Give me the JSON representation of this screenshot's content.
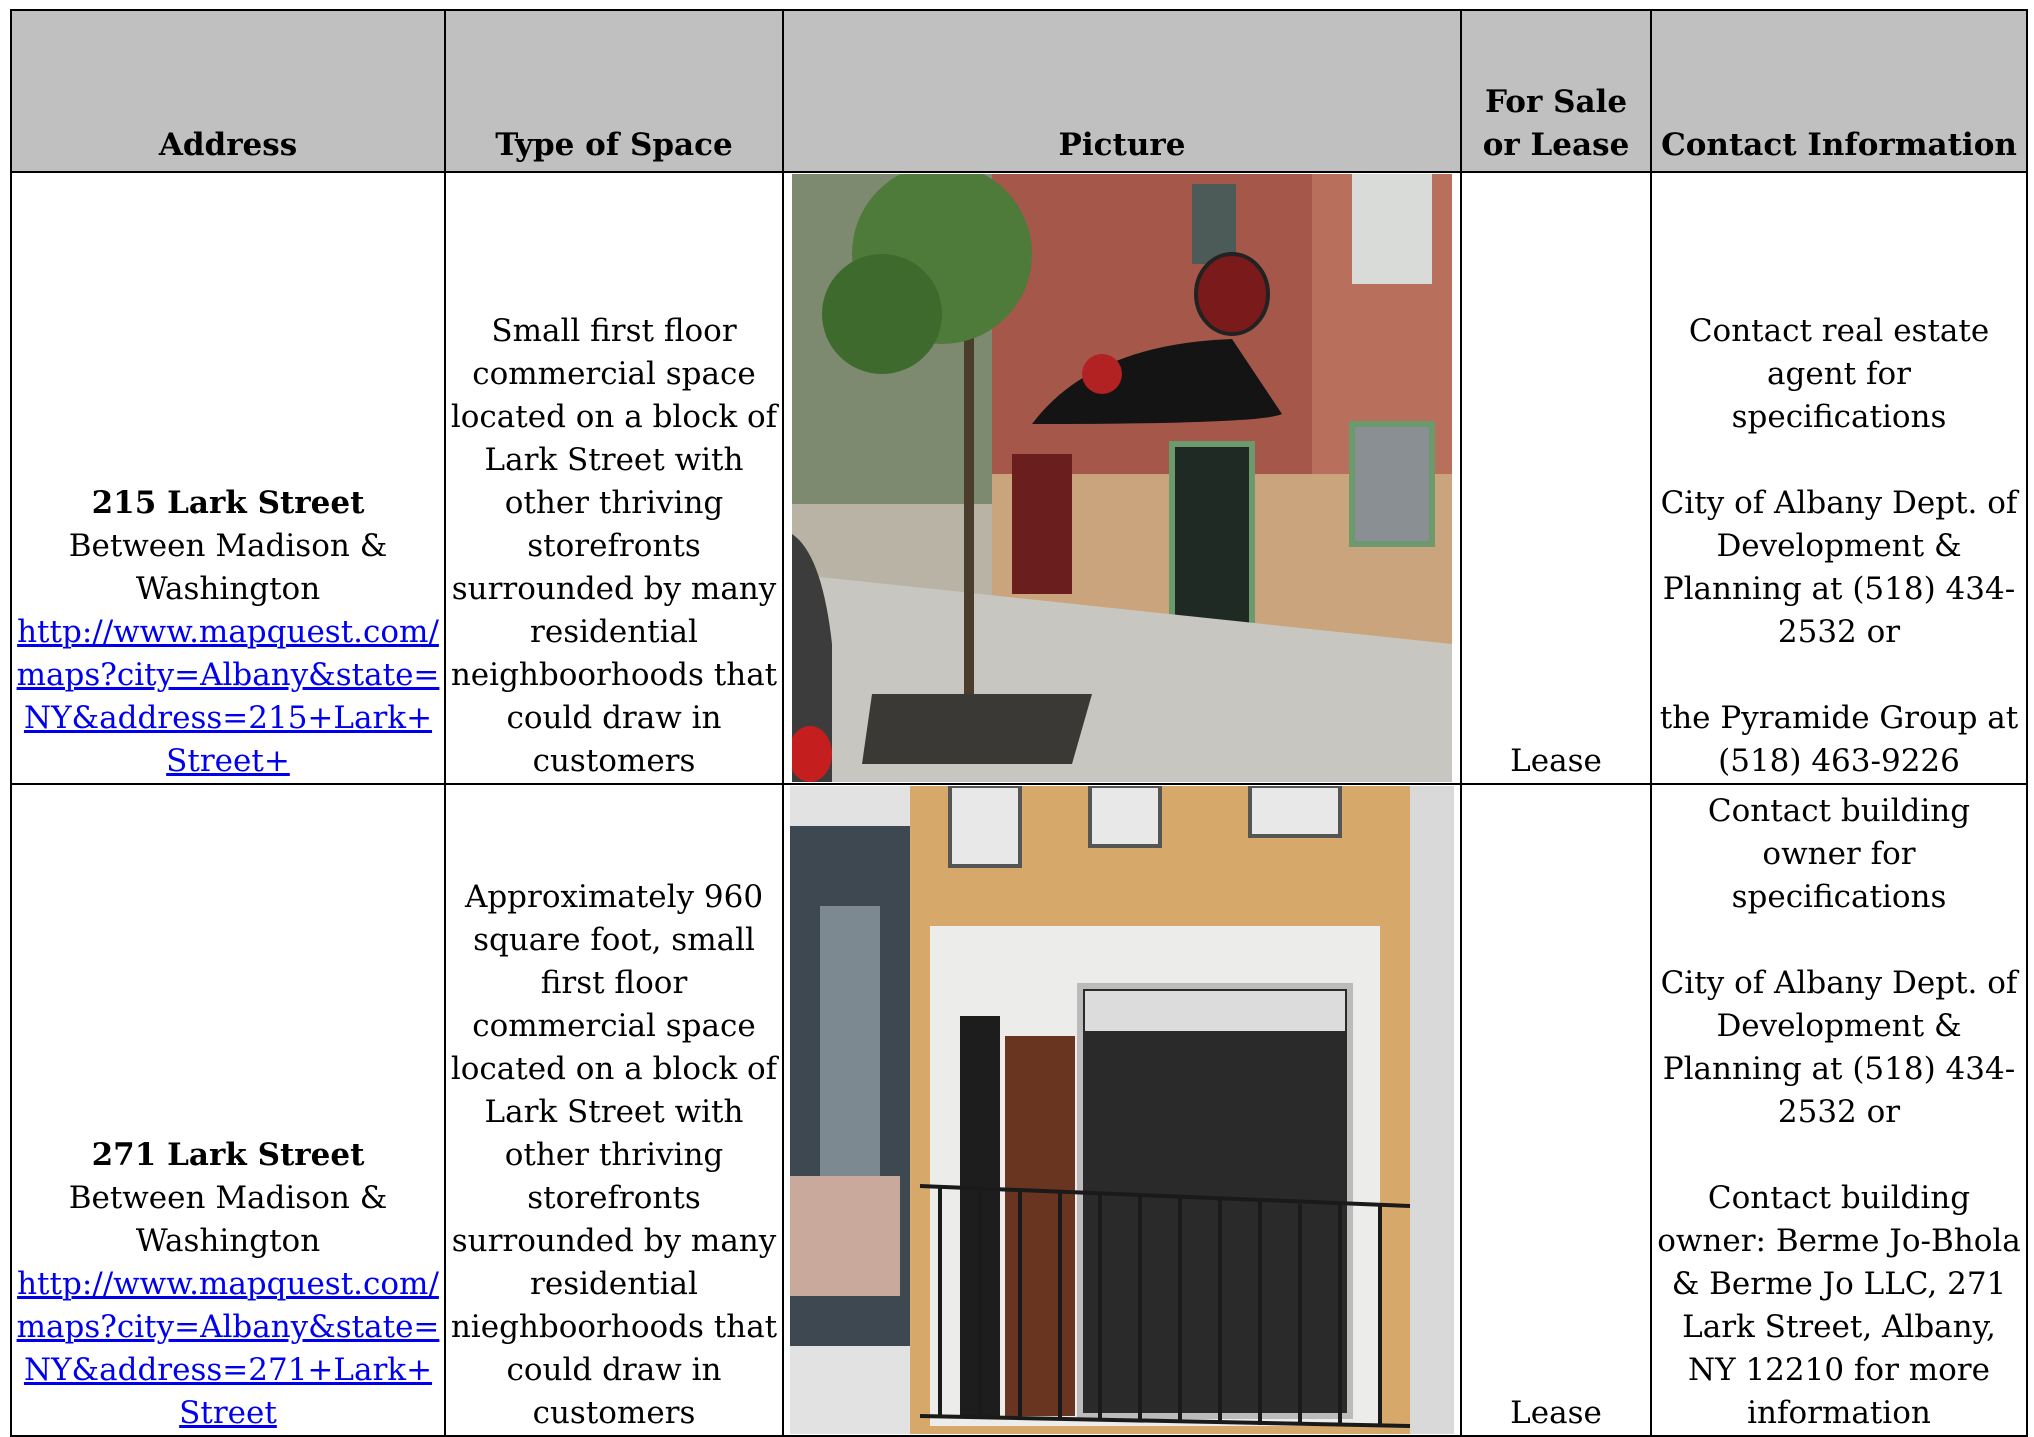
{
  "headers": {
    "address": "Address",
    "type": "Type of Space",
    "picture": "Picture",
    "sale_lease": "For Sale or Lease",
    "contact": "Contact Information"
  },
  "rows": [
    {
      "address_name": "215 Lark Street",
      "address_between": "Between Madison & Washington",
      "address_link": "http://www.mapquest.com/maps?city=Albany&state=NY&address=215+Lark+Street+",
      "type": "Small first floor commercial space located on a block of Lark Street with other thriving storefronts surrounded by many residential neighboorhoods that could draw in customers",
      "picture_alt": "Storefront with black awning and hanging sign on Lark Street",
      "sale_lease": "Lease",
      "contact": "Contact real estate agent for specifications\n\nCity of Albany Dept. of Development & Planning at (518) 434-2532 or\n\nthe Pyramide Group at (518) 463-9226"
    },
    {
      "address_name": "271 Lark Street",
      "address_between": "Between Madison & Washington",
      "address_link": "http://www.mapquest.com/maps?city=Albany&state=NY&address=271+Lark+Street",
      "type": "Approximately 960 square foot, small first floor commercial space located on a block of Lark Street with other thriving storefronts surrounded by many residential nieghboorhoods that could draw in customers",
      "picture_alt": "Yellow brick storefront with large window and iron fence",
      "sale_lease": "Lease",
      "contact": "Contact building owner for specifications\n\nCity of Albany Dept. of Development & Planning at (518) 434-2532 or\n\nContact building owner: Berme Jo-Bhola & Berme Jo LLC, 271 Lark Street, Albany, NY 12210 for more information"
    }
  ]
}
